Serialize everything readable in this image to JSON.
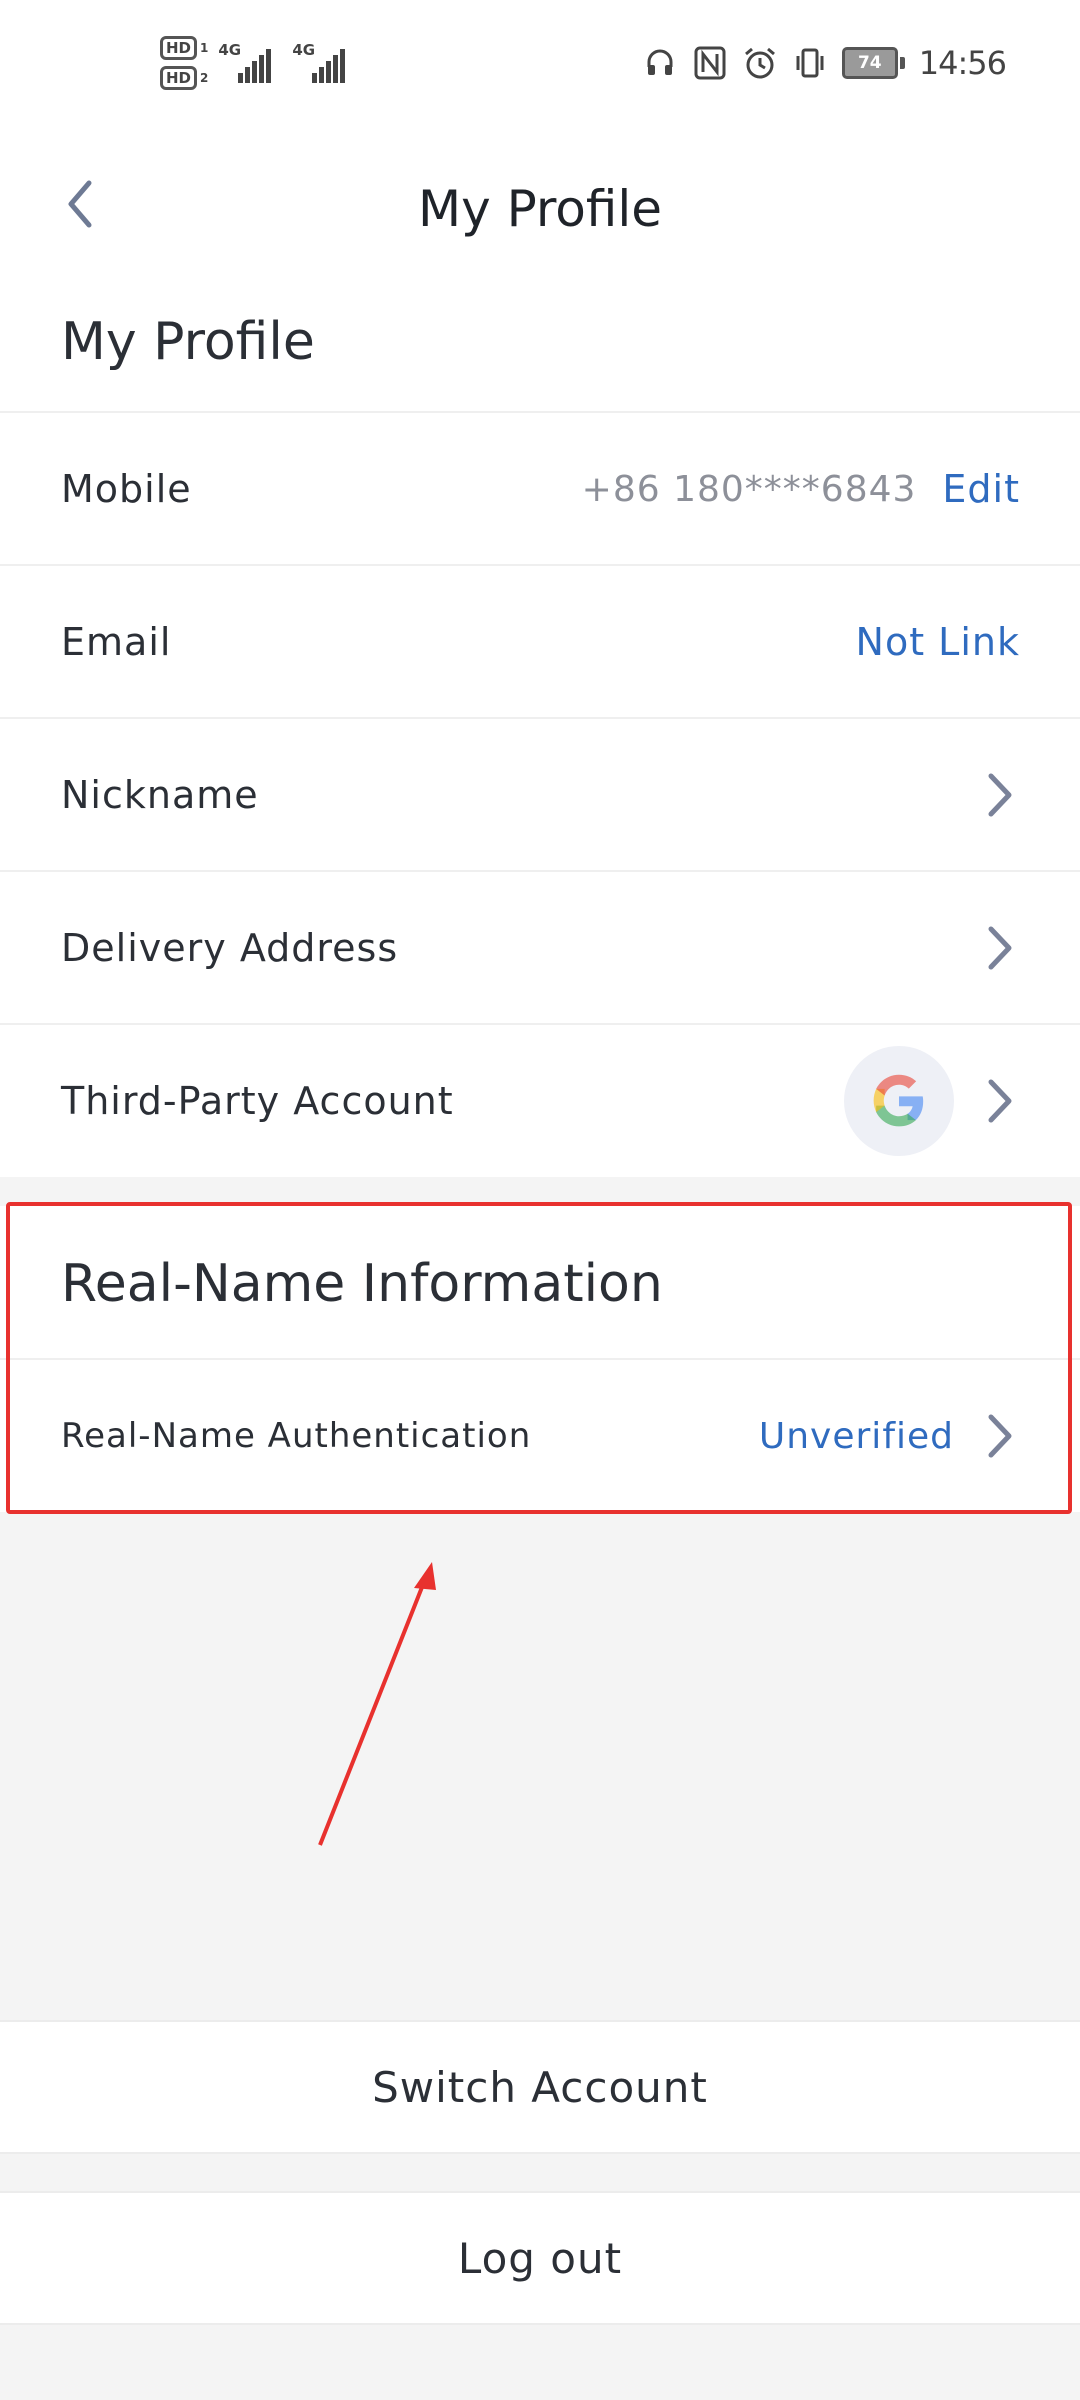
{
  "status_bar": {
    "sim1_label": "HD",
    "sim1_index": "1",
    "sim2_label": "HD",
    "sim2_index": "2",
    "net1": "4G",
    "net2": "4G",
    "battery": "74",
    "time": "14:56"
  },
  "nav": {
    "title": "My Profile",
    "back_icon": "chevron-left-icon"
  },
  "profile": {
    "section_title": "My Profile",
    "rows": {
      "mobile": {
        "label": "Mobile",
        "value": "+86 180****6843",
        "action": "Edit"
      },
      "email": {
        "label": "Email",
        "value": "Not Link"
      },
      "nickname": {
        "label": "Nickname"
      },
      "delivery": {
        "label": "Delivery Address"
      },
      "third_party": {
        "label": "Third-Party Account",
        "provider_icon": "google-icon"
      }
    }
  },
  "real_name": {
    "section_title": "Real-Name Information",
    "row": {
      "label": "Real-Name Authentication",
      "value": "Unverified"
    }
  },
  "buttons": {
    "switch_account": "Switch Account",
    "logout": "Log out"
  },
  "colors": {
    "accent_link": "#2f6bbf",
    "highlight": "#e8312e",
    "background": "#f4f4f4"
  }
}
